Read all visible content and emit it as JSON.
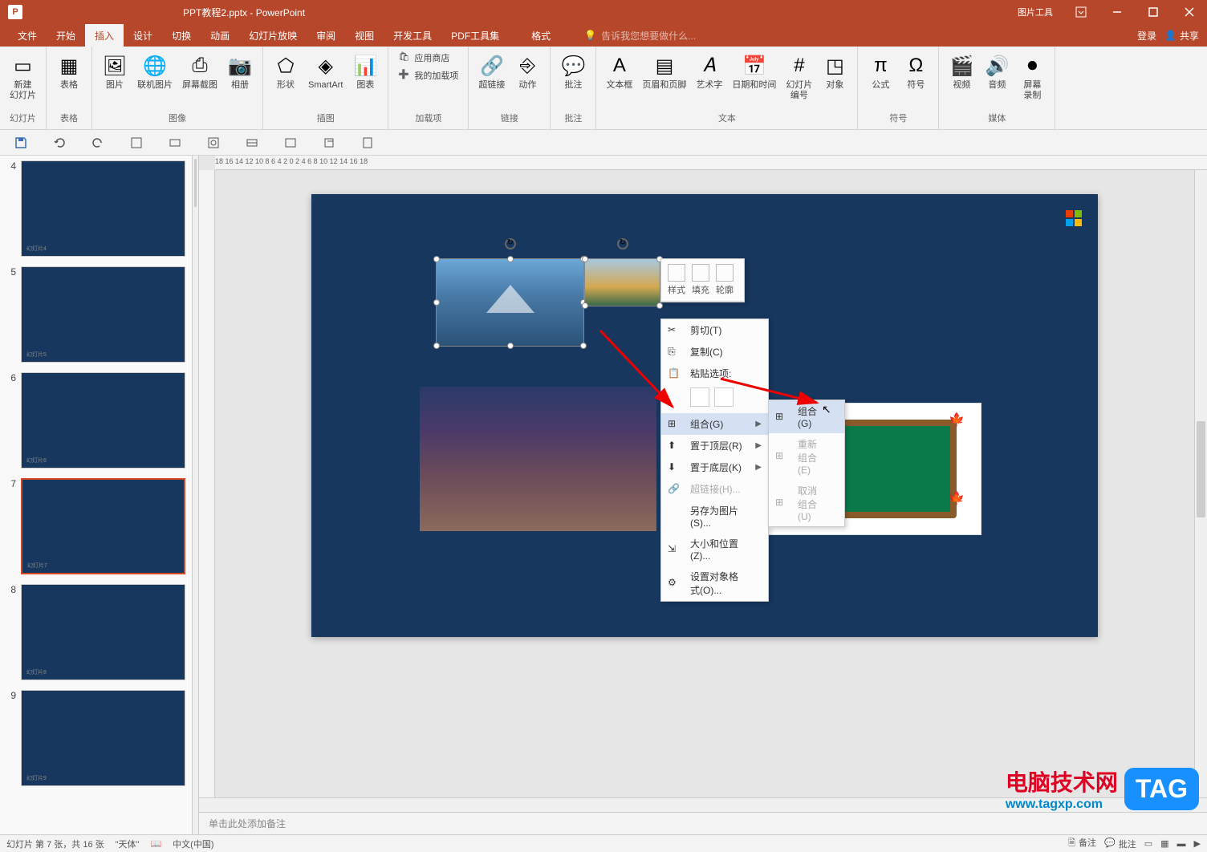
{
  "titlebar": {
    "app_icon": "P",
    "title": "PPT教程2.pptx - PowerPoint",
    "tool_tab": "图片工具"
  },
  "menubar": {
    "tabs": [
      "文件",
      "开始",
      "插入",
      "设计",
      "切换",
      "动画",
      "幻灯片放映",
      "审阅",
      "视图",
      "开发工具",
      "PDF工具集"
    ],
    "active_tab": "插入",
    "tool_sub": "格式",
    "tell_me_placeholder": "告诉我您想要做什么...",
    "login": "登录",
    "share": "共享"
  },
  "ribbon": {
    "groups": [
      {
        "label": "幻灯片",
        "items": [
          {
            "name": "新建\n幻灯片"
          }
        ]
      },
      {
        "label": "表格",
        "items": [
          {
            "name": "表格"
          }
        ]
      },
      {
        "label": "图像",
        "items": [
          {
            "name": "图片"
          },
          {
            "name": "联机图片"
          },
          {
            "name": "屏幕截图"
          },
          {
            "name": "相册"
          }
        ]
      },
      {
        "label": "插图",
        "items": [
          {
            "name": "形状"
          },
          {
            "name": "SmartArt"
          },
          {
            "name": "图表"
          }
        ]
      },
      {
        "label": "加载项",
        "items": [
          {
            "name": "应用商店"
          },
          {
            "name": "我的加载项"
          }
        ],
        "stacked": true
      },
      {
        "label": "链接",
        "items": [
          {
            "name": "超链接"
          },
          {
            "name": "动作"
          }
        ]
      },
      {
        "label": "批注",
        "items": [
          {
            "name": "批注"
          }
        ]
      },
      {
        "label": "文本",
        "items": [
          {
            "name": "文本框"
          },
          {
            "name": "页眉和页脚"
          },
          {
            "name": "艺术字"
          },
          {
            "name": "日期和时间"
          },
          {
            "name": "幻灯片\n编号"
          },
          {
            "name": "对象"
          }
        ]
      },
      {
        "label": "符号",
        "items": [
          {
            "name": "公式"
          },
          {
            "name": "符号"
          }
        ]
      },
      {
        "label": "媒体",
        "items": [
          {
            "name": "视频"
          },
          {
            "name": "音频"
          },
          {
            "name": "屏幕\n录制"
          }
        ]
      }
    ]
  },
  "slides": {
    "visible": [
      {
        "num": "4",
        "star": true
      },
      {
        "num": "5"
      },
      {
        "num": "6"
      },
      {
        "num": "7",
        "active": true,
        "star": true
      },
      {
        "num": "8"
      },
      {
        "num": "9"
      }
    ]
  },
  "context_menu": {
    "mini_toolbar": [
      {
        "label": "样式"
      },
      {
        "label": "填充"
      },
      {
        "label": "轮廓"
      }
    ],
    "items": [
      {
        "label": "剪切(T)",
        "icon": "cut"
      },
      {
        "label": "复制(C)",
        "icon": "copy"
      },
      {
        "label": "粘贴选项:",
        "icon": "paste",
        "paste_row": true
      },
      {
        "label": "组合(G)",
        "icon": "group",
        "arrow": true,
        "hover": true
      },
      {
        "label": "置于顶层(R)",
        "icon": "front",
        "arrow": true
      },
      {
        "label": "置于底层(K)",
        "icon": "back",
        "arrow": true
      },
      {
        "label": "超链接(H)...",
        "icon": "link",
        "disabled": true
      },
      {
        "label": "另存为图片(S)...",
        "icon": ""
      },
      {
        "label": "大小和位置(Z)...",
        "icon": "size"
      },
      {
        "label": "设置对象格式(O)...",
        "icon": "format"
      }
    ],
    "submenu": [
      {
        "label": "组合(G)",
        "icon": "group",
        "hover": true
      },
      {
        "label": "重新组合(E)",
        "icon": "regroup",
        "disabled": true
      },
      {
        "label": "取消组合(U)",
        "icon": "ungroup",
        "disabled": true
      }
    ]
  },
  "ruler": "  18      16      14      12      10      8       6       4       2       0       2       4       6       8       10      12      14      16      18",
  "notes_placeholder": "单击此处添加备注",
  "statusbar": {
    "slide_info": "幻灯片 第 7 张，共 16 张",
    "theme": "\"天体\"",
    "lang": "中文(中国)",
    "notes": "备注",
    "comments": "批注"
  },
  "watermark": {
    "line1": "电脑技术网",
    "line2": "www.tagxp.com",
    "tag": "TAG"
  }
}
